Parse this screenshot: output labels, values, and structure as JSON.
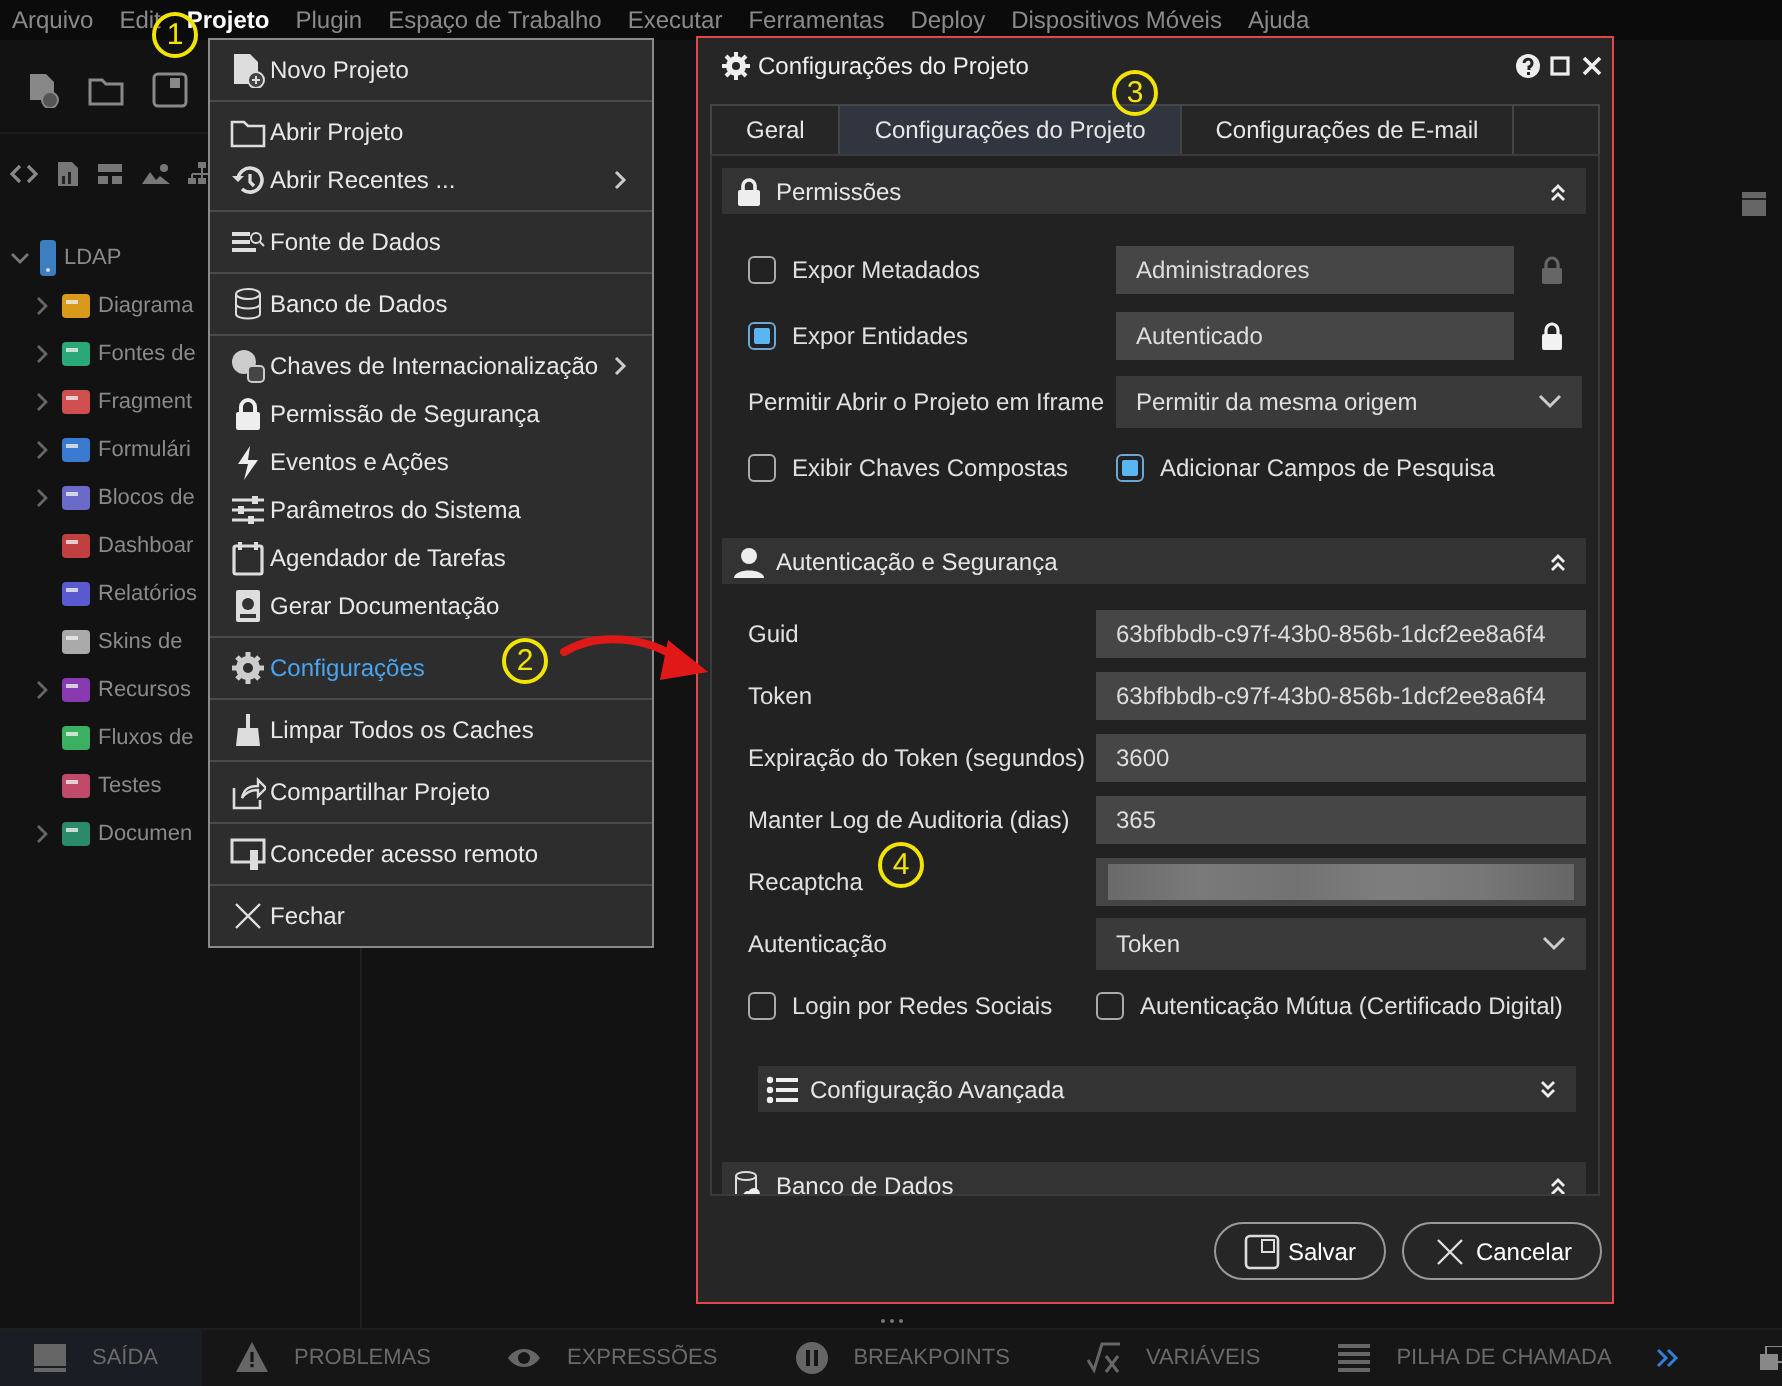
{
  "menubar": [
    {
      "label": "Arquivo",
      "selected": false
    },
    {
      "label": "Edit",
      "selected": false
    },
    {
      "label": "Projeto",
      "selected": true
    },
    {
      "label": "Plugin",
      "selected": false
    },
    {
      "label": "Espaço de Trabalho",
      "selected": false
    },
    {
      "label": "Executar",
      "selected": false
    },
    {
      "label": "Ferramentas",
      "selected": false
    },
    {
      "label": "Deploy",
      "selected": false
    },
    {
      "label": "Dispositivos Móveis",
      "selected": false
    },
    {
      "label": "Ajuda",
      "selected": false
    }
  ],
  "tree": {
    "label": "LDAP",
    "expanded": true,
    "children": [
      {
        "label": "Diagrama",
        "expandable": true
      },
      {
        "label": "Fontes de",
        "expandable": true
      },
      {
        "label": "Fragment",
        "expandable": true
      },
      {
        "label": "Formulári",
        "expandable": true
      },
      {
        "label": "Blocos de",
        "expandable": true
      },
      {
        "label": "Dashboar",
        "expandable": false
      },
      {
        "label": "Relatórios",
        "expandable": false
      },
      {
        "label": "Skins de",
        "expandable": false
      },
      {
        "label": "Recursos",
        "expandable": true
      },
      {
        "label": "Fluxos de",
        "expandable": false
      },
      {
        "label": "Testes",
        "expandable": false
      },
      {
        "label": "Documen",
        "expandable": true
      }
    ]
  },
  "project_menu": {
    "groups": [
      [
        {
          "label": "Novo Projeto",
          "selected": false,
          "submenu": false
        }
      ],
      [
        {
          "label": "Abrir Projeto",
          "selected": false,
          "submenu": false
        },
        {
          "label": "Abrir Recentes ...",
          "selected": false,
          "submenu": true
        }
      ],
      [
        {
          "label": "Fonte de Dados",
          "selected": false,
          "submenu": false
        }
      ],
      [
        {
          "label": "Banco de Dados",
          "selected": false,
          "submenu": false
        }
      ],
      [
        {
          "label": "Chaves de Internacionalização",
          "selected": false,
          "submenu": true
        },
        {
          "label": "Permissão de Segurança",
          "selected": false,
          "submenu": false
        },
        {
          "label": "Eventos e Ações",
          "selected": false,
          "submenu": false
        },
        {
          "label": "Parâmetros do Sistema",
          "selected": false,
          "submenu": false
        },
        {
          "label": "Agendador de Tarefas",
          "selected": false,
          "submenu": false
        },
        {
          "label": "Gerar Documentação",
          "selected": false,
          "submenu": false
        }
      ],
      [
        {
          "label": "Configurações",
          "selected": true,
          "submenu": false
        }
      ],
      [
        {
          "label": "Limpar Todos os Caches",
          "selected": false,
          "submenu": false
        }
      ],
      [
        {
          "label": "Compartilhar Projeto",
          "selected": false,
          "submenu": false
        }
      ],
      [
        {
          "label": "Conceder acesso remoto",
          "selected": false,
          "submenu": false
        }
      ],
      [
        {
          "label": "Fechar",
          "selected": false,
          "submenu": false
        }
      ]
    ]
  },
  "dialog": {
    "title": "Configurações do Projeto",
    "tabs": [
      {
        "label": "Geral",
        "selected": false
      },
      {
        "label": "Configurações do Projeto",
        "selected": true
      },
      {
        "label": "Configurações de E-mail",
        "selected": false
      }
    ],
    "sections": [
      {
        "title": "Permissões",
        "expanded": true,
        "rows": [
          {
            "kind": "check_field",
            "label": "Expor Metadados",
            "checked": false,
            "value": "Administradores",
            "locked": false
          },
          {
            "kind": "check_field",
            "label": "Expor Entidades",
            "checked": true,
            "value": "Autenticado",
            "locked": true
          },
          {
            "kind": "select",
            "label": "Permitir Abrir o Projeto em Iframe",
            "value": "Permitir da mesma origem"
          },
          {
            "kind": "check_pair",
            "items": [
              {
                "label": "Exibir Chaves Compostas",
                "checked": false
              },
              {
                "label": "Adicionar Campos de Pesquisa",
                "checked": true
              }
            ]
          }
        ]
      },
      {
        "title": "Autenticação e Segurança",
        "expanded": true,
        "rows": [
          {
            "kind": "field",
            "label": "Guid",
            "value": "63bfbbdb-c97f-43b0-856b-1dcf2ee8a6f4"
          },
          {
            "kind": "field",
            "label": "Token",
            "value": "63bfbbdb-c97f-43b0-856b-1dcf2ee8a6f4"
          },
          {
            "kind": "field",
            "label": "Expiração do Token (segundos)",
            "value": "3600"
          },
          {
            "kind": "field",
            "label": "Manter Log de Auditoria (dias)",
            "value": "365"
          },
          {
            "kind": "blurred",
            "label": "Recaptcha"
          },
          {
            "kind": "select",
            "label": "Autenticação",
            "value": "Token"
          },
          {
            "kind": "check_pair",
            "items": [
              {
                "label": "Login por Redes Sociais",
                "checked": false
              },
              {
                "label": "Autenticação Mútua (Certificado Digital)",
                "checked": false
              }
            ]
          },
          {
            "kind": "subsection",
            "title": "Configuração Avançada",
            "expanded": false
          }
        ]
      },
      {
        "title": "Banco de Dados",
        "expanded": true
      }
    ],
    "buttons": [
      {
        "label": "Salvar",
        "kind": "save"
      },
      {
        "label": "Cancelar",
        "kind": "cancel"
      }
    ]
  },
  "bottom_tabs": [
    {
      "label": "SAÍDA",
      "selected": true
    },
    {
      "label": "PROBLEMAS",
      "selected": false
    },
    {
      "label": "EXPRESSÕES",
      "selected": false
    },
    {
      "label": "BREAKPOINTS",
      "selected": false
    },
    {
      "label": "VARIÁVEIS",
      "selected": false
    },
    {
      "label": "PILHA DE CHAMADA",
      "selected": false
    }
  ],
  "annotations": [
    {
      "label": "1"
    },
    {
      "label": "2"
    },
    {
      "label": "3"
    },
    {
      "label": "4"
    }
  ]
}
